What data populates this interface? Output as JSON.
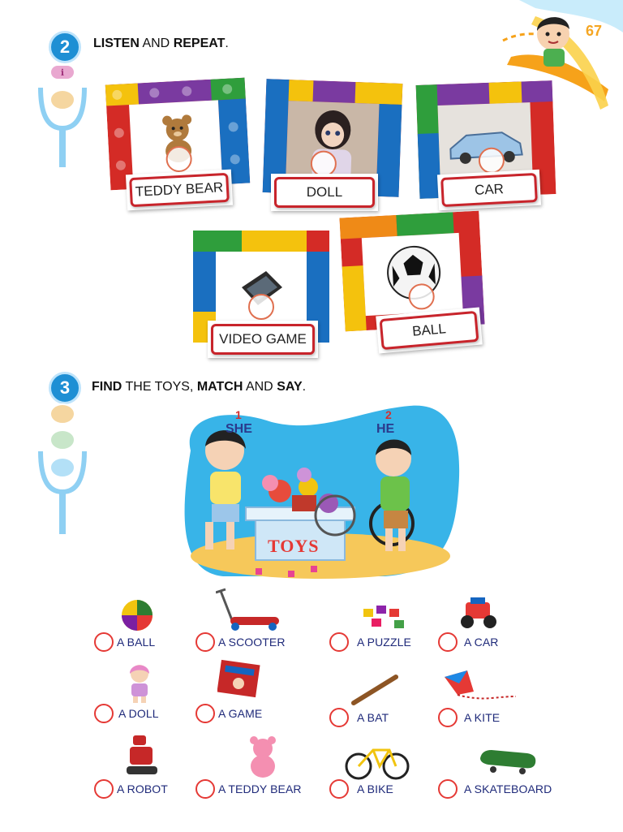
{
  "page_number": "67",
  "section2": {
    "number": "2",
    "heading_bold1": "LISTEN",
    "heading_mid": " AND ",
    "heading_bold2": "REPEAT",
    "heading_end": ".",
    "cards": [
      {
        "label": "TEDDY BEAR",
        "icon": "teddy-bear-icon"
      },
      {
        "label": "DOLL",
        "icon": "doll-icon"
      },
      {
        "label": "CAR",
        "icon": "car-icon"
      },
      {
        "label": "VIDEO GAME",
        "icon": "video-game-icon"
      },
      {
        "label": "BALL",
        "icon": "ball-icon"
      }
    ]
  },
  "section3": {
    "number": "3",
    "heading_bold1": "FIND",
    "heading_mid1": " THE TOYS, ",
    "heading_bold2": "MATCH",
    "heading_mid2": " AND ",
    "heading_bold3": "SAY",
    "heading_end": ".",
    "scene": {
      "she_num": "1",
      "she_label": "SHE",
      "he_num": "2",
      "he_label": "HE",
      "box_label": "TOYS"
    },
    "options": [
      {
        "label": "A BALL",
        "icon": "ball-icon"
      },
      {
        "label": "A SCOOTER",
        "icon": "scooter-icon"
      },
      {
        "label": "A PUZZLE",
        "icon": "puzzle-icon"
      },
      {
        "label": "A CAR",
        "icon": "toy-car-icon"
      },
      {
        "label": "A DOLL",
        "icon": "doll-icon"
      },
      {
        "label": "A GAME",
        "icon": "board-game-icon"
      },
      {
        "label": "A BAT",
        "icon": "bat-icon"
      },
      {
        "label": "A KITE",
        "icon": "kite-icon"
      },
      {
        "label": "A ROBOT",
        "icon": "robot-icon"
      },
      {
        "label": "A TEDDY BEAR",
        "icon": "teddy-bear-icon"
      },
      {
        "label": "A BIKE",
        "icon": "bike-icon"
      },
      {
        "label": "A SKATEBOARD",
        "icon": "skateboard-icon"
      }
    ]
  },
  "colors": {
    "badge": "#1e8fd4",
    "label_border": "#c8242b",
    "option_text": "#1f2a7a",
    "page_number": "#f5a623"
  }
}
